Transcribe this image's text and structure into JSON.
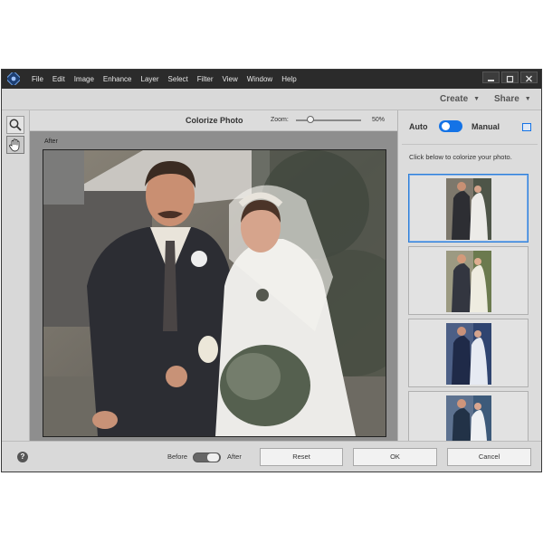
{
  "menu": {
    "items": [
      "File",
      "Edit",
      "Image",
      "Enhance",
      "Layer",
      "Select",
      "Filter",
      "View",
      "Window",
      "Help"
    ]
  },
  "actions": {
    "create": "Create",
    "share": "Share"
  },
  "toolbar": {
    "title": "Colorize Photo",
    "zoom_label": "Zoom:",
    "zoom_value": "50%",
    "zoom_level": 0.5
  },
  "canvas": {
    "view_label": "After"
  },
  "panel": {
    "auto_label": "Auto",
    "manual_label": "Manual",
    "mode": "Auto",
    "hint": "Click below to colorize your photo."
  },
  "bottom": {
    "help": "?",
    "before_label": "Before",
    "after_label": "After",
    "reset_label": "Reset",
    "ok_label": "OK",
    "cancel_label": "Cancel"
  },
  "colors": {
    "accent": "#1473e6",
    "menubar": "#2b2b2b"
  }
}
